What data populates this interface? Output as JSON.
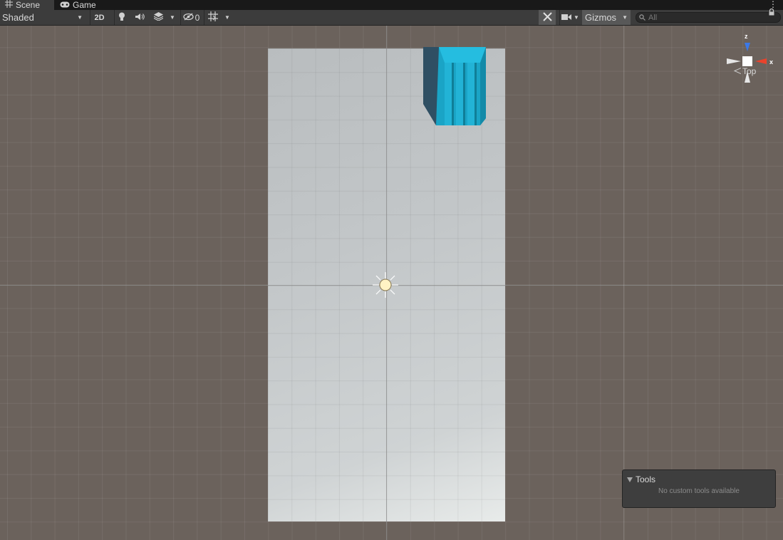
{
  "tabs": [
    {
      "label": "Scene",
      "icon": "grid-icon",
      "active": true
    },
    {
      "label": "Game",
      "icon": "gamepad-icon",
      "active": false
    }
  ],
  "toolbar": {
    "shading_mode": "Shaded",
    "mode_2d": "2D",
    "hidden_count": "0",
    "gizmos_label": "Gizmos",
    "search_placeholder": "All"
  },
  "gizmo": {
    "y_axis_label": "z",
    "x_axis_label": "x",
    "view_label": "Top",
    "colors": {
      "x": "#e9432c",
      "z": "#3b79e8",
      "neutral": "#e6e6e6"
    }
  },
  "tools_panel": {
    "title": "Tools",
    "message": "No custom tools available"
  },
  "scene": {
    "floor_color": "#c5c9cb",
    "object_color": "#1ea9c9",
    "background_color": "#6b625c"
  }
}
